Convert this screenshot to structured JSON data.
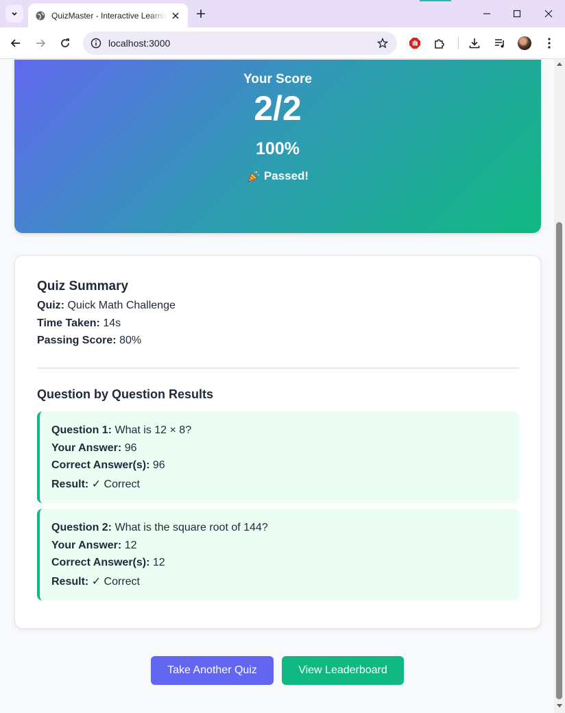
{
  "browser": {
    "tab_title": "QuizMaster - Interactive Learning",
    "url": "localhost:3000",
    "icons": {
      "tab_menu": "chevron-down-icon",
      "favicon": "globe-icon",
      "tab_close": "close-icon",
      "new_tab": "plus-icon",
      "back": "arrow-left-icon",
      "forward": "arrow-right-icon",
      "reload": "reload-icon",
      "site_info": "info-icon",
      "bookmark": "star-icon",
      "extension_1": "shield-hand-icon",
      "extensions": "puzzle-icon",
      "downloads": "download-icon",
      "media": "media-queue-icon",
      "menu": "kebab-menu-icon"
    }
  },
  "score": {
    "label": "Your Score",
    "value": "2/2",
    "percent": "100%",
    "status": "Passed!",
    "status_icon": "party-popper-icon"
  },
  "summary": {
    "title": "Quiz Summary",
    "quiz_label": "Quiz:",
    "quiz_value": "Quick Math Challenge",
    "time_label": "Time Taken:",
    "time_value": "14s",
    "passing_label": "Passing Score:",
    "passing_value": "80%"
  },
  "results": {
    "title": "Question by Question Results",
    "items": [
      {
        "question_label": "Question 1:",
        "question_text": "What is 12 × 8?",
        "answer_label": "Your Answer:",
        "answer_value": "96",
        "correct_label": "Correct Answer(s):",
        "correct_value": "96",
        "result_label": "Result:",
        "result_value": "✓ Correct"
      },
      {
        "question_label": "Question 2:",
        "question_text": "What is the square root of 144?",
        "answer_label": "Your Answer:",
        "answer_value": "12",
        "correct_label": "Correct Answer(s):",
        "correct_value": "12",
        "result_label": "Result:",
        "result_value": "✓ Correct"
      }
    ]
  },
  "actions": {
    "take_another": "Take Another Quiz",
    "leaderboard": "View Leaderboard"
  },
  "colors": {
    "primary": "#6366f1",
    "success": "#10b981",
    "result_bg": "#ecfdf3"
  }
}
